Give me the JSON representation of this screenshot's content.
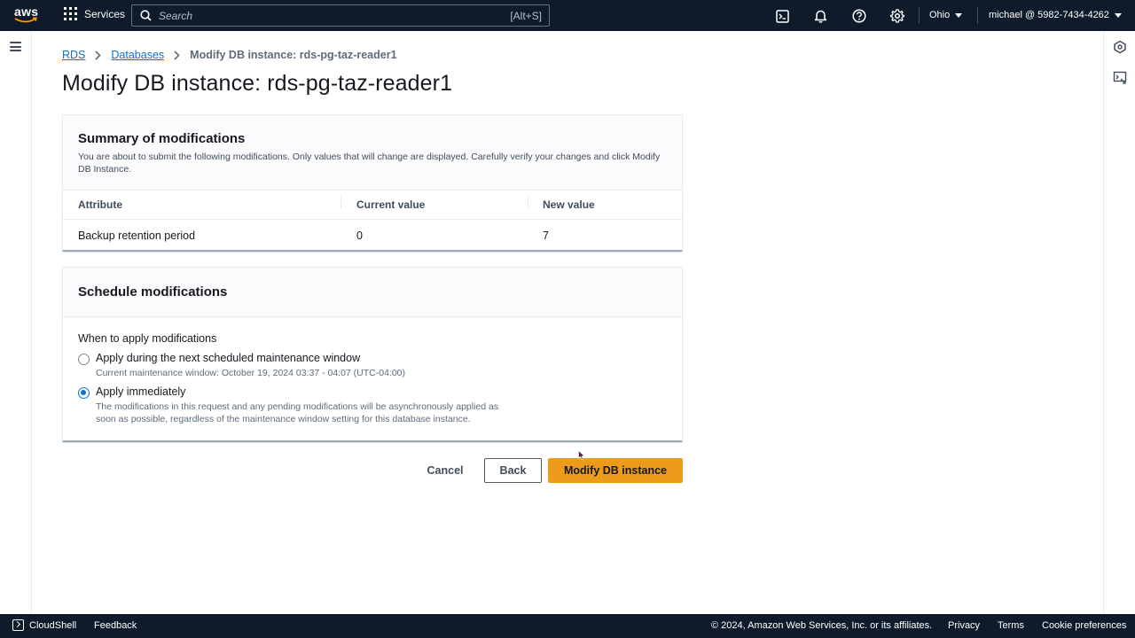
{
  "topnav": {
    "logo_text": "aws",
    "services_label": "Services",
    "search_placeholder": "Search",
    "search_shortcut": "[Alt+S]",
    "region": "Ohio",
    "account": "michael @ 5982-7434-4262",
    "icons": [
      "cloudshell-icon",
      "bell-icon",
      "help-icon",
      "gear-icon"
    ]
  },
  "breadcrumb": {
    "items": [
      "RDS",
      "Databases"
    ],
    "current": "Modify DB instance: rds-pg-taz-reader1"
  },
  "page_title": "Modify DB instance: rds-pg-taz-reader1",
  "summary": {
    "title": "Summary of modifications",
    "description": "You are about to submit the following modifications. Only values that will change are displayed. Carefully verify your changes and click Modify DB Instance.",
    "columns": [
      "Attribute",
      "Current value",
      "New value"
    ],
    "rows": [
      [
        "Backup retention period",
        "0",
        "7"
      ]
    ]
  },
  "schedule": {
    "title": "Schedule modifications",
    "field_label": "When to apply modifications",
    "options": [
      {
        "label": "Apply during the next scheduled maintenance window",
        "description": "Current maintenance window: October 19, 2024 03:37 - 04:07 (UTC-04:00)",
        "selected": false
      },
      {
        "label": "Apply immediately",
        "description": "The modifications in this request and any pending modifications will be asynchronously applied as soon as possible, regardless of the maintenance window setting for this database instance.",
        "selected": true
      }
    ]
  },
  "actions": {
    "cancel": "Cancel",
    "back": "Back",
    "submit": "Modify DB instance"
  },
  "footer": {
    "cloudshell": "CloudShell",
    "feedback": "Feedback",
    "copyright": "© 2024, Amazon Web Services, Inc. or its affiliates.",
    "privacy": "Privacy",
    "terms": "Terms",
    "cookies": "Cookie preferences"
  },
  "colors": {
    "nav_bg": "#0f1b2a",
    "link": "#0972d3",
    "primary_button": "#ec9b1a"
  }
}
